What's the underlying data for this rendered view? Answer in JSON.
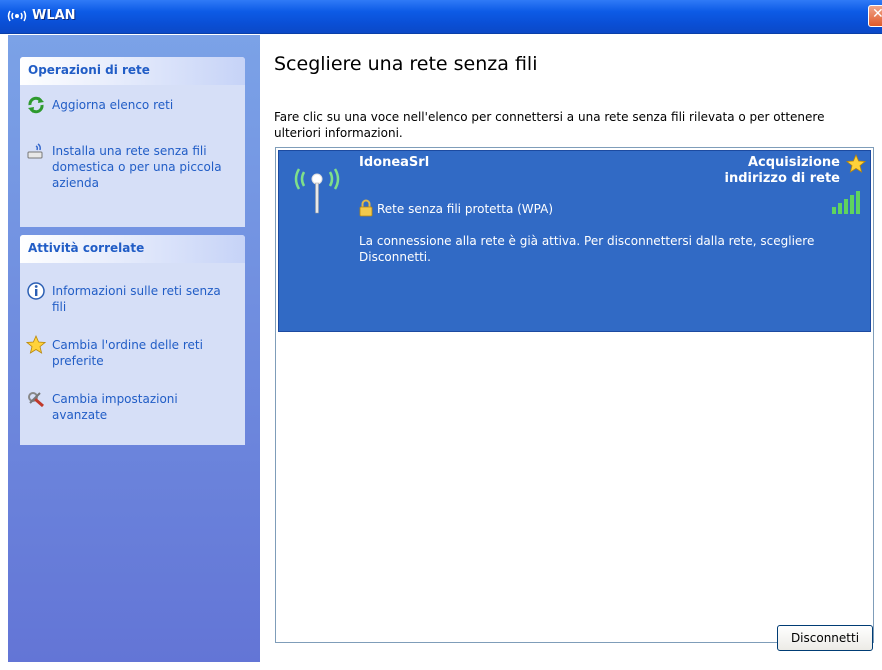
{
  "window": {
    "title": "WLAN"
  },
  "sidebar": {
    "network_tasks": {
      "header": "Operazioni di rete",
      "items": [
        {
          "label": "Aggiorna elenco reti",
          "icon": "refresh-icon"
        },
        {
          "label": "Installa una rete senza fili domestica o per una piccola azienda",
          "icon": "wireless-setup-icon"
        }
      ]
    },
    "related_tasks": {
      "header": "Attività correlate",
      "items": [
        {
          "label": "Informazioni sulle reti senza fili",
          "icon": "info-icon"
        },
        {
          "label": "Cambia l'ordine delle reti preferite",
          "icon": "star-icon"
        },
        {
          "label": "Cambia impostazioni avanzate",
          "icon": "settings-icon"
        }
      ]
    }
  },
  "main": {
    "title": "Scegliere una rete senza fili",
    "subtitle": "Fare clic su una voce nell'elenco per connettersi a una rete senza fili rilevata o per ottenere ulteriori informazioni.",
    "networks": [
      {
        "ssid": "IdoneaSrl",
        "status": "Acquisizione indirizzo di rete",
        "security": "Rete senza fili protetta (WPA)",
        "description": "La connessione alla rete è già attiva. Per disconnettersi dalla rete, scegliere Disconnetti.",
        "selected": true,
        "signal_bars": 5
      }
    ],
    "disconnect_label": "Disconnetti"
  },
  "colors": {
    "titlebar": "#0a4fd6",
    "selection": "#316ac5",
    "link": "#215dc6",
    "sidebar": "#6f8cdd"
  }
}
